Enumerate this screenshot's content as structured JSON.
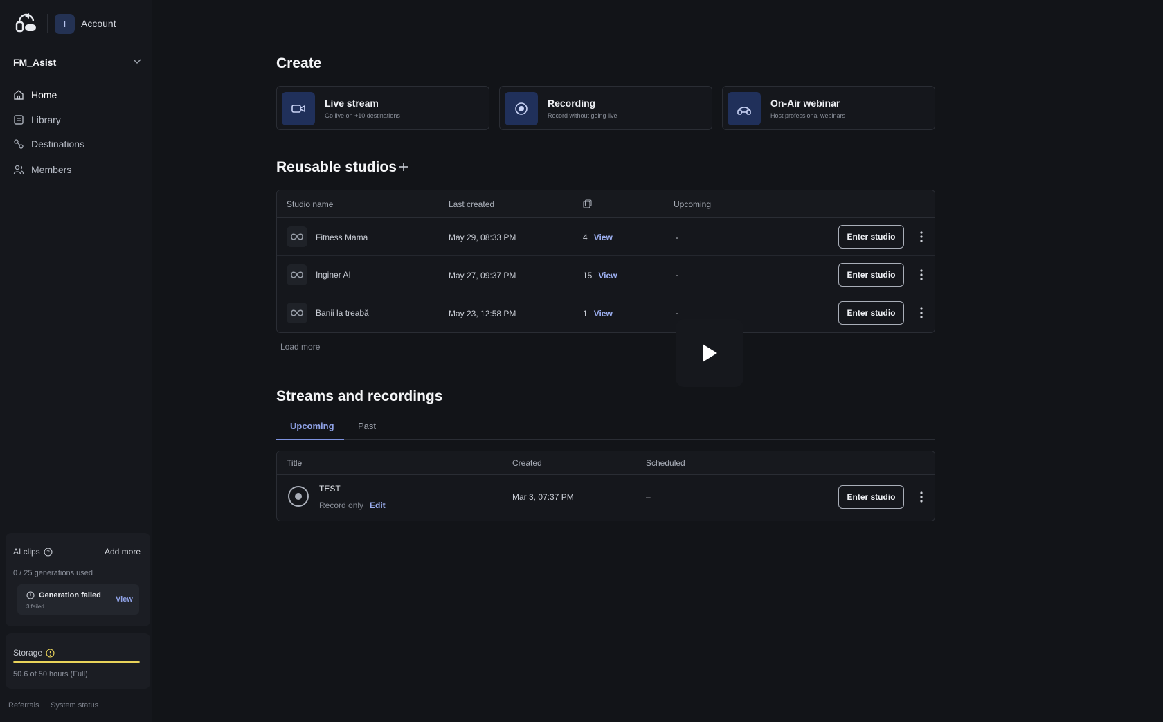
{
  "account": {
    "initial": "I",
    "label": "Account"
  },
  "workspace": {
    "name": "FM_Asist"
  },
  "nav": [
    {
      "label": "Home",
      "icon": "home-icon",
      "active": true
    },
    {
      "label": "Library",
      "icon": "library-icon"
    },
    {
      "label": "Destinations",
      "icon": "destinations-icon"
    },
    {
      "label": "Members",
      "icon": "members-icon"
    }
  ],
  "ai_clips": {
    "title": "AI clips",
    "add_more": "Add more",
    "usage": "0 / 25 generations used",
    "generation_failed": {
      "title": "Generation failed",
      "sub": "3 failed",
      "view": "View"
    }
  },
  "storage": {
    "title": "Storage",
    "usage": "50.6 of 50 hours (Full)",
    "fill_percent": 100,
    "bar_color": "#e9d35a"
  },
  "footer": {
    "referrals": "Referrals",
    "system_status": "System status"
  },
  "create": {
    "heading": "Create",
    "cards": [
      {
        "title": "Live stream",
        "subtitle": "Go live on +10 destinations",
        "icon": "video-camera-icon"
      },
      {
        "title": "Recording",
        "subtitle": "Record without going live",
        "icon": "record-icon"
      },
      {
        "title": "On-Air webinar",
        "subtitle": "Host professional webinars",
        "icon": "webinar-icon"
      }
    ]
  },
  "studios": {
    "heading": "Reusable studios",
    "columns": {
      "name": "Studio name",
      "last_created": "Last created",
      "upcoming": "Upcoming"
    },
    "rows": [
      {
        "name": "Fitness Mama",
        "last_created": "May 29, 08:33 PM",
        "count": "4",
        "view": "View",
        "upcoming": "-",
        "enter": "Enter studio"
      },
      {
        "name": "Inginer AI",
        "last_created": "May 27, 09:37 PM",
        "count": "15",
        "view": "View",
        "upcoming": "-",
        "enter": "Enter studio"
      },
      {
        "name": "Banii la treabă",
        "last_created": "May 23, 12:58 PM",
        "count": "1",
        "view": "View",
        "upcoming": "-",
        "enter": "Enter studio"
      }
    ],
    "load_more": "Load more"
  },
  "streams": {
    "heading": "Streams and recordings",
    "tabs": [
      {
        "label": "Upcoming",
        "active": true
      },
      {
        "label": "Past"
      }
    ],
    "columns": {
      "title": "Title",
      "created": "Created",
      "scheduled": "Scheduled"
    },
    "rows": [
      {
        "title": "TEST",
        "type": "Record only",
        "edit": "Edit",
        "created": "Mar 3, 07:37 PM",
        "scheduled": "–",
        "enter": "Enter studio"
      }
    ]
  },
  "colors": {
    "accent": "#8fa2e6",
    "background": "#121418",
    "sidebar": "#15171c"
  }
}
